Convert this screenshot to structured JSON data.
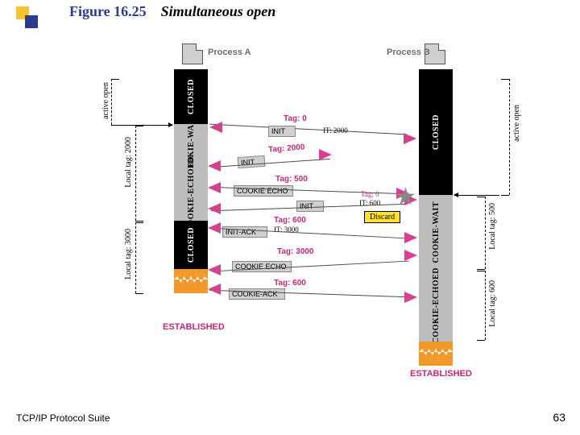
{
  "title": {
    "fig": "Figure 16.25",
    "sub": "Simultaneous open"
  },
  "footer": "TCP/IP Protocol Suite",
  "page": "63",
  "process": {
    "a": "Process A",
    "b": "Process B"
  },
  "statesA": [
    "CLOSED",
    "COOKIE-WAIT",
    "COOKIE-ECHOED",
    "CLOSED"
  ],
  "statesB": [
    "CLOSED",
    "COOKIE-WAIT",
    "COOKIE-ECHOED"
  ],
  "established": "ESTABLISHED",
  "rulersLeft": {
    "open": "active open",
    "tag": "Local tag: 2000",
    "tag2": "Local tag: 3000"
  },
  "rulersRight": {
    "open": "active open",
    "tag": "Local tag: 500",
    "tag2": "Local tag: 600"
  },
  "messages": {
    "m1": {
      "tag": "Tag: 0",
      "info": "IT: 2000",
      "chunk": "INIT"
    },
    "m2": {
      "tag": "Tag: 2000",
      "chunk": "INIT"
    },
    "m3": {
      "tag": "Tag: 500",
      "chunk": "COOKIE ECHO"
    },
    "m4": {
      "tag": "Tag: 0",
      "info": "IT: 600",
      "chunk": "INIT"
    },
    "m5": {
      "tag": "Tag: 600",
      "info": "IT: 3000",
      "chunk": "INIT-ACK"
    },
    "m6": {
      "tag": "Tag: 3000",
      "chunk": "COOKIE ECHO"
    },
    "m7": {
      "tag": "Tag: 600",
      "chunk": "COOKIE-ACK"
    }
  },
  "discard": "Discard"
}
